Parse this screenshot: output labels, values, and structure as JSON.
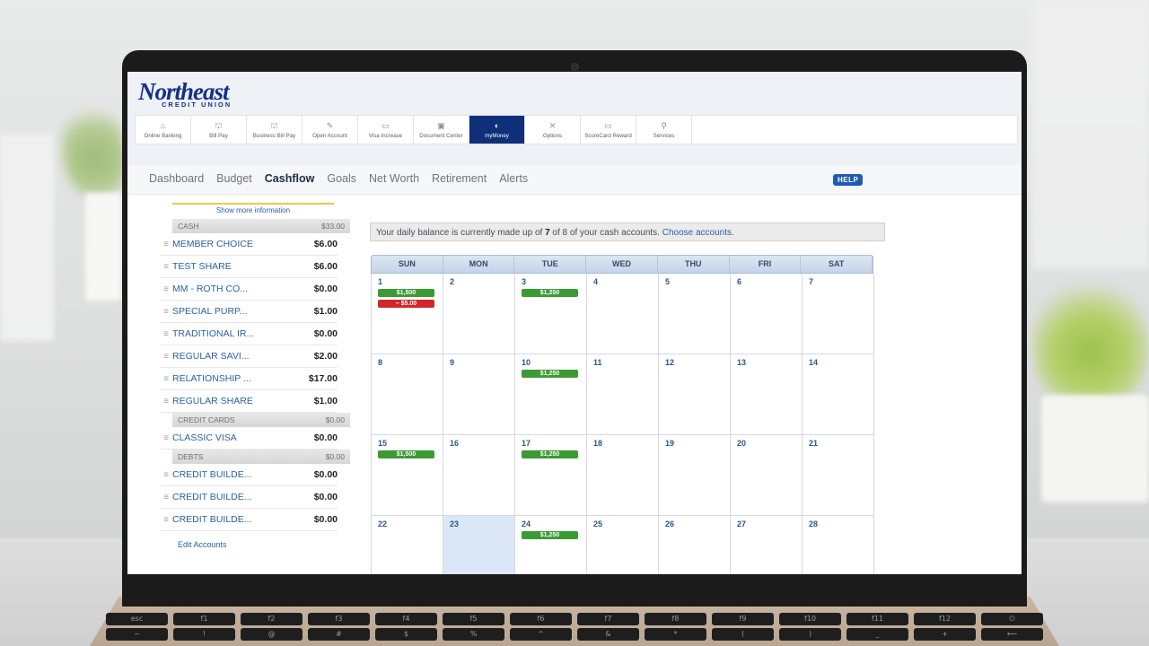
{
  "brand": {
    "name": "Northeast",
    "subtitle": "CREDIT UNION"
  },
  "nav": [
    {
      "label": "Online Banking",
      "icon": "home-icon"
    },
    {
      "label": "Bill Pay",
      "icon": "bank-icon"
    },
    {
      "label": "Business Bill Pay",
      "icon": "bank-icon"
    },
    {
      "label": "Open Account",
      "icon": "edit-icon"
    },
    {
      "label": "Visa Increase",
      "icon": "card-icon"
    },
    {
      "label": "Document Center",
      "icon": "briefcase-icon"
    },
    {
      "label": "myMoney",
      "icon": "money-icon",
      "active": true
    },
    {
      "label": "Options",
      "icon": "tools-icon"
    },
    {
      "label": "ScoreCard Reward",
      "icon": "card-icon"
    },
    {
      "label": "Services",
      "icon": "pin-icon"
    }
  ],
  "subnav": {
    "items": [
      "Dashboard",
      "Budget",
      "Cashflow",
      "Goals",
      "Net Worth",
      "Retirement",
      "Alerts"
    ],
    "active": "Cashflow",
    "help": "HELP"
  },
  "accounts": {
    "show_more": "Show more information",
    "groups": [
      {
        "name": "CASH",
        "total": "$33.00",
        "items": [
          {
            "name": "MEMBER CHOICE",
            "balance": "$6.00"
          },
          {
            "name": "TEST SHARE",
            "balance": "$6.00"
          },
          {
            "name": "MM - ROTH CO...",
            "balance": "$0.00"
          },
          {
            "name": "SPECIAL PURP...",
            "balance": "$1.00"
          },
          {
            "name": "TRADITIONAL IR...",
            "balance": "$0.00"
          },
          {
            "name": "REGULAR SAVI...",
            "balance": "$2.00"
          },
          {
            "name": "RELATIONSHIP ...",
            "balance": "$17.00"
          },
          {
            "name": "REGULAR SHARE",
            "balance": "$1.00"
          }
        ]
      },
      {
        "name": "CREDIT CARDS",
        "total": "$0.00",
        "items": [
          {
            "name": "CLASSIC VISA",
            "balance": "$0.00"
          }
        ]
      },
      {
        "name": "DEBTS",
        "total": "$0.00",
        "items": [
          {
            "name": "CREDIT BUILDE...",
            "balance": "$0.00"
          },
          {
            "name": "CREDIT BUILDE...",
            "balance": "$0.00"
          },
          {
            "name": "CREDIT BUILDE...",
            "balance": "$0.00"
          }
        ]
      }
    ],
    "edit": "Edit Accounts"
  },
  "balance_info": {
    "prefix": "Your daily balance is currently made up of ",
    "count": "7",
    "mid": " of 8 of your cash accounts. ",
    "link": "Choose accounts."
  },
  "calendar": {
    "days": [
      "SUN",
      "MON",
      "TUE",
      "WED",
      "THU",
      "FRI",
      "SAT"
    ],
    "today": 23,
    "weeks": [
      [
        {
          "d": "1",
          "ev": [
            {
              "t": "$1,500",
              "c": "g"
            },
            {
              "t": "– $5.00",
              "c": "r"
            }
          ]
        },
        {
          "d": "2"
        },
        {
          "d": "3",
          "ev": [
            {
              "t": "$1,250",
              "c": "g"
            }
          ]
        },
        {
          "d": "4"
        },
        {
          "d": "5"
        },
        {
          "d": "6"
        },
        {
          "d": "7"
        }
      ],
      [
        {
          "d": "8"
        },
        {
          "d": "9"
        },
        {
          "d": "10",
          "ev": [
            {
              "t": "$1,250",
              "c": "g"
            }
          ]
        },
        {
          "d": "11"
        },
        {
          "d": "12"
        },
        {
          "d": "13"
        },
        {
          "d": "14"
        }
      ],
      [
        {
          "d": "15",
          "ev": [
            {
              "t": "$1,500",
              "c": "g"
            }
          ]
        },
        {
          "d": "16"
        },
        {
          "d": "17",
          "ev": [
            {
              "t": "$1,250",
              "c": "g"
            }
          ]
        },
        {
          "d": "18"
        },
        {
          "d": "19"
        },
        {
          "d": "20"
        },
        {
          "d": "21"
        }
      ],
      [
        {
          "d": "22"
        },
        {
          "d": "23"
        },
        {
          "d": "24",
          "ev": [
            {
              "t": "$1,250",
              "c": "g"
            }
          ]
        },
        {
          "d": "25"
        },
        {
          "d": "26"
        },
        {
          "d": "27"
        },
        {
          "d": "28"
        }
      ]
    ]
  },
  "keyboard": {
    "fn_row": [
      "esc",
      "f1",
      "f2",
      "f3",
      "f4",
      "f5",
      "f6",
      "f7",
      "f8",
      "f9",
      "f10",
      "f11",
      "f12",
      "⏻"
    ],
    "num_row": [
      "~",
      "!",
      "@",
      "#",
      "$",
      "%",
      "^",
      "&",
      "*",
      "(",
      ")",
      "_",
      "+",
      "⟵"
    ]
  }
}
